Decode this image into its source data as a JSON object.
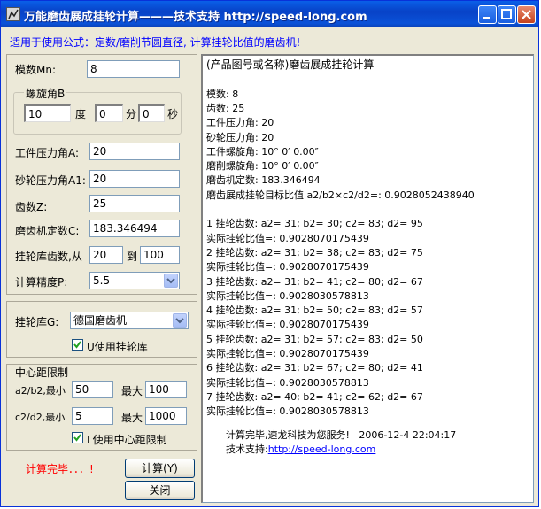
{
  "window": {
    "title": "万能磨齿展成挂轮计算———技术支持 http://speed-long.com"
  },
  "formula_note": "适用于使用公式：定数/磨削节圆直径, 计算挂轮比值的磨齿机!",
  "params": {
    "module_label": "模数Mn:",
    "module_value": "8",
    "helix_group_title": "螺旋角B",
    "helix_deg": "10",
    "deg_unit": "度",
    "helix_min": "0",
    "min_unit": "分",
    "helix_sec": "0",
    "sec_unit": "秒",
    "work_pressure_label": "工件压力角A:",
    "work_pressure_value": "20",
    "wheel_pressure_label": "砂轮压力角A1:",
    "wheel_pressure_value": "20",
    "teeth_label": "齿数Z:",
    "teeth_value": "25",
    "constant_label": "磨齿机定数C:",
    "constant_value": "183.346494",
    "gear_range_label": "挂轮库齿数,从",
    "gear_from": "20",
    "to_label": "到",
    "gear_to": "100",
    "precision_label": "计算精度P:",
    "precision_value": "5.5"
  },
  "gearlib": {
    "label": "挂轮库G:",
    "value": "德国磨齿机",
    "use_lib_label": "U使用挂轮库",
    "use_lib_checked": true
  },
  "center": {
    "group_title": "中心距限制",
    "a2b2_label": "a2/b2,最小",
    "a2b2_min": "50",
    "a2b2_max_label": "最大",
    "a2b2_max": "100",
    "c2d2_label": "c2/d2,最小",
    "c2d2_min": "5",
    "c2d2_max_label": "最大",
    "c2d2_max": "1000",
    "use_center_label": "L使用中心距限制",
    "use_center_checked": true
  },
  "status_text": "计算完毕．．．!",
  "buttons": {
    "calc": "计算(Y)",
    "close": "关闭"
  },
  "results": {
    "lines": [
      "(产品图号或名称)磨齿展成挂轮计算",
      "",
      "模数: 8",
      "齿数: 25",
      "工件压力角: 20",
      "砂轮压力角: 20",
      "工件螺旋角: 10° 0′ 0.00″",
      "磨削螺旋角: 10° 0′ 0.00″",
      "磨齿机定数: 183.346494",
      "磨齿展成挂轮目标比值 a2/b2×c2/d2=: 0.9028052438940",
      "",
      " 1  挂轮齿数: a2= 31; b2= 30; c2= 83; d2= 95",
      "实际挂轮比值=: 0.9028070175439",
      " 2  挂轮齿数: a2= 31; b2= 38; c2= 83; d2= 75",
      "实际挂轮比值=: 0.9028070175439",
      " 3  挂轮齿数: a2= 31; b2= 41; c2= 80; d2= 67",
      "实际挂轮比值=: 0.9028030578813",
      " 4  挂轮齿数: a2= 31; b2= 50; c2= 83; d2= 57",
      "实际挂轮比值=: 0.9028070175439",
      " 5  挂轮齿数: a2= 31; b2= 57; c2= 83; d2= 50",
      "实际挂轮比值=: 0.9028070175439",
      " 6  挂轮齿数: a2= 31; b2= 67; c2= 80; d2= 41",
      "实际挂轮比值=: 0.9028030578813",
      " 7  挂轮齿数: a2= 40; b2= 41; c2= 62; d2= 67",
      "实际挂轮比值=: 0.9028030578813",
      ""
    ],
    "footer_done": "计算完毕,速龙科技为您服务!",
    "footer_time": "2006-12-4 22:04:17",
    "footer_support": "技术支持:",
    "footer_link": "http://speed-long.com"
  }
}
